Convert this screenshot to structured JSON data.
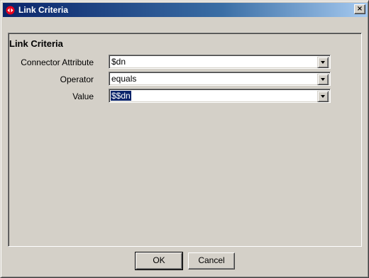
{
  "window": {
    "title": "Link Criteria",
    "close_glyph": "×",
    "icon": "app-logo-icon"
  },
  "panel": {
    "title": "Link Criteria"
  },
  "fields": [
    {
      "label": "Connector Attribute",
      "value": "$dn"
    },
    {
      "label": "Operator",
      "value": "equals"
    },
    {
      "label": "Value",
      "value": "$$dn"
    }
  ],
  "buttons": {
    "ok_label": "OK",
    "cancel_label": "Cancel"
  },
  "colors": {
    "titlebar_start": "#0a246a",
    "titlebar_end": "#a6caf0",
    "face": "#d4d0c8",
    "selection": "#0a246a"
  }
}
